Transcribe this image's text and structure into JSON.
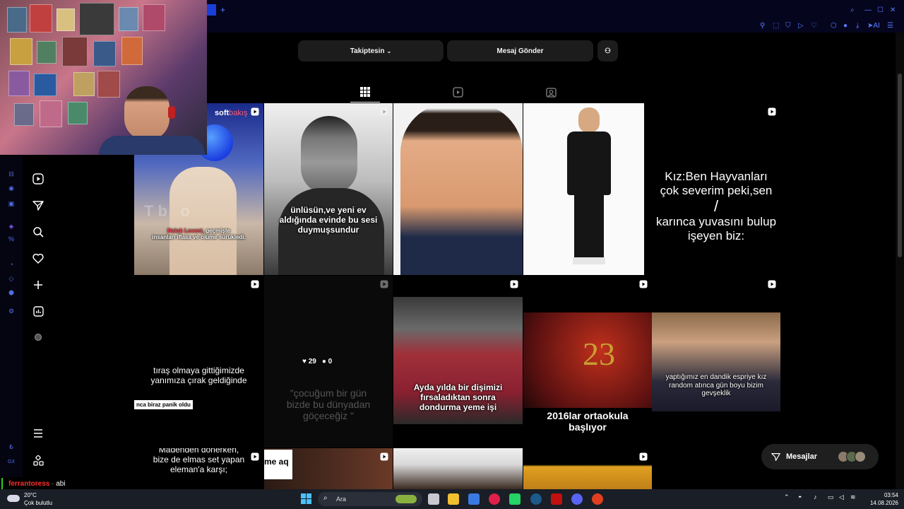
{
  "browser": {
    "new_tab": "+",
    "ai_label": "AI"
  },
  "profile": {
    "follow_label": "Takiptesin",
    "message_label": "Mesaj Gönder"
  },
  "grid": {
    "row1": [
      {
        "brand": "soft",
        "brand2": "bakış",
        "faded": "T b   o",
        "caption_name": "Haluk Levent,",
        "caption_rest": " geçmişte",
        "caption_line2": "insanları iflasa ve ölüme sürükledi."
      },
      {
        "caption": "ünlüsün,ve yeni ev aldığında evinde bu sesi duymuşsundur"
      },
      {},
      {},
      {
        "line1": "Kız:Ben Hayvanları",
        "line2": "çok severim peki,sen",
        "line3": "/",
        "line4": "karınca yuvasını bulup",
        "line5": "işeyen biz:"
      }
    ],
    "row2": [
      {
        "caption": "tıraş olmaya gittiğimizde yanımıza çırak geldiğinde",
        "label": "nca biraz panik oldu"
      },
      {
        "likes": "29",
        "comments": "0",
        "caption": "\"çocuğum bir gün bizde bu dünyadan göçeceğiz \""
      },
      {
        "caption": "Ayda yılda bir dişimizi fırsaladıktan sonra dondurma yeme işi"
      },
      {
        "big_number": "23",
        "caption": "2016lar ortaokula başlıyor"
      },
      {
        "caption": "yaptığımız en dandik espriye kız random atınca gün boyu bizim gevşeklik"
      }
    ],
    "row3": [
      {
        "caption": "Madenden dönerken, bize de elmas set yapan eleman'a karşı;"
      },
      {
        "label": "me aq"
      },
      {},
      {}
    ]
  },
  "messages": {
    "label": "Mesajlar"
  },
  "chat": {
    "user": "ferrantoress",
    "separator": " · ",
    "message": "abi"
  },
  "taskbar": {
    "weather_temp": "20°C",
    "weather_desc": "Çok bulutlu",
    "search_label": "Ara",
    "time": "03:54",
    "date": "14.08.2026"
  },
  "colors": {
    "accent": "#0095f6",
    "browser_icon": "#5b7cff",
    "bg": "#000000",
    "button_bg": "#1c1c1c"
  }
}
